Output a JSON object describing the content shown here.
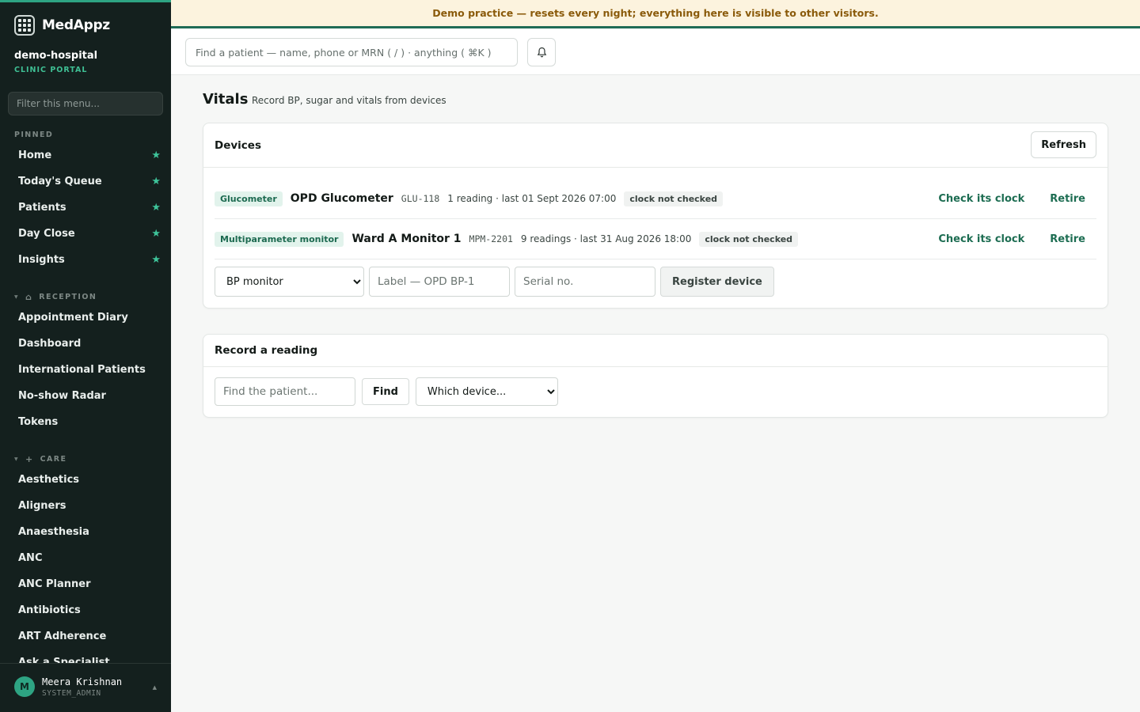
{
  "brand": {
    "name": "MedAppz",
    "logo_icon": "grid-logo-icon"
  },
  "org": {
    "name": "demo-hospital",
    "portal": "CLINIC PORTAL"
  },
  "sidebar": {
    "filter_placeholder": "Filter this menu...",
    "pinned_label": "PINNED",
    "pinned": [
      {
        "label": "Home"
      },
      {
        "label": "Today's Queue"
      },
      {
        "label": "Patients"
      },
      {
        "label": "Day Close"
      },
      {
        "label": "Insights"
      }
    ],
    "reception_label": "RECEPTION",
    "reception": [
      {
        "label": "Appointment Diary"
      },
      {
        "label": "Dashboard"
      },
      {
        "label": "International Patients"
      },
      {
        "label": "No-show Radar"
      },
      {
        "label": "Tokens"
      }
    ],
    "care_label": "CARE",
    "care": [
      {
        "label": "Aesthetics"
      },
      {
        "label": "Aligners"
      },
      {
        "label": "Anaesthesia"
      },
      {
        "label": "ANC"
      },
      {
        "label": "ANC Planner"
      },
      {
        "label": "Antibiotics"
      },
      {
        "label": "ART Adherence"
      },
      {
        "label": "Ask a Specialist"
      }
    ]
  },
  "user": {
    "initial": "M",
    "name": "Meera Krishnan",
    "role": "SYSTEM_ADMIN"
  },
  "banner": {
    "text": "Demo practice — resets every night; everything here is visible to other visitors."
  },
  "search": {
    "placeholder": "Find a patient — name, phone or MRN ( / ) · anything ( ⌘K )"
  },
  "page": {
    "title": "Vitals",
    "subtitle": "Record BP, sugar and vitals from devices"
  },
  "devices": {
    "title": "Devices",
    "refresh_label": "Refresh",
    "rows": [
      {
        "type": "Glucometer",
        "name": "OPD Glucometer",
        "serial": "GLU-118",
        "readings": "1 reading · last 01 Sept 2026 07:00",
        "clock": "clock not checked",
        "check_label": "Check its clock",
        "retire_label": "Retire"
      },
      {
        "type": "Multiparameter monitor",
        "name": "Ward A Monitor 1",
        "serial": "MPM-2201",
        "readings": "9 readings · last 31 Aug 2026 18:00",
        "clock": "clock not checked",
        "check_label": "Check its clock",
        "retire_label": "Retire"
      }
    ],
    "register": {
      "type_selected": "BP monitor",
      "label_placeholder": "Label — OPD BP-1",
      "serial_placeholder": "Serial no.",
      "button_label": "Register device"
    }
  },
  "record": {
    "title": "Record a reading",
    "patient_placeholder": "Find the patient...",
    "find_label": "Find",
    "device_selected": "Which device..."
  },
  "colors": {
    "accent": "#2ea483",
    "sidebar_bg": "#14201e",
    "link": "#1d6d52",
    "banner_bg": "#fcf3de",
    "banner_text": "#8a5a0a"
  }
}
